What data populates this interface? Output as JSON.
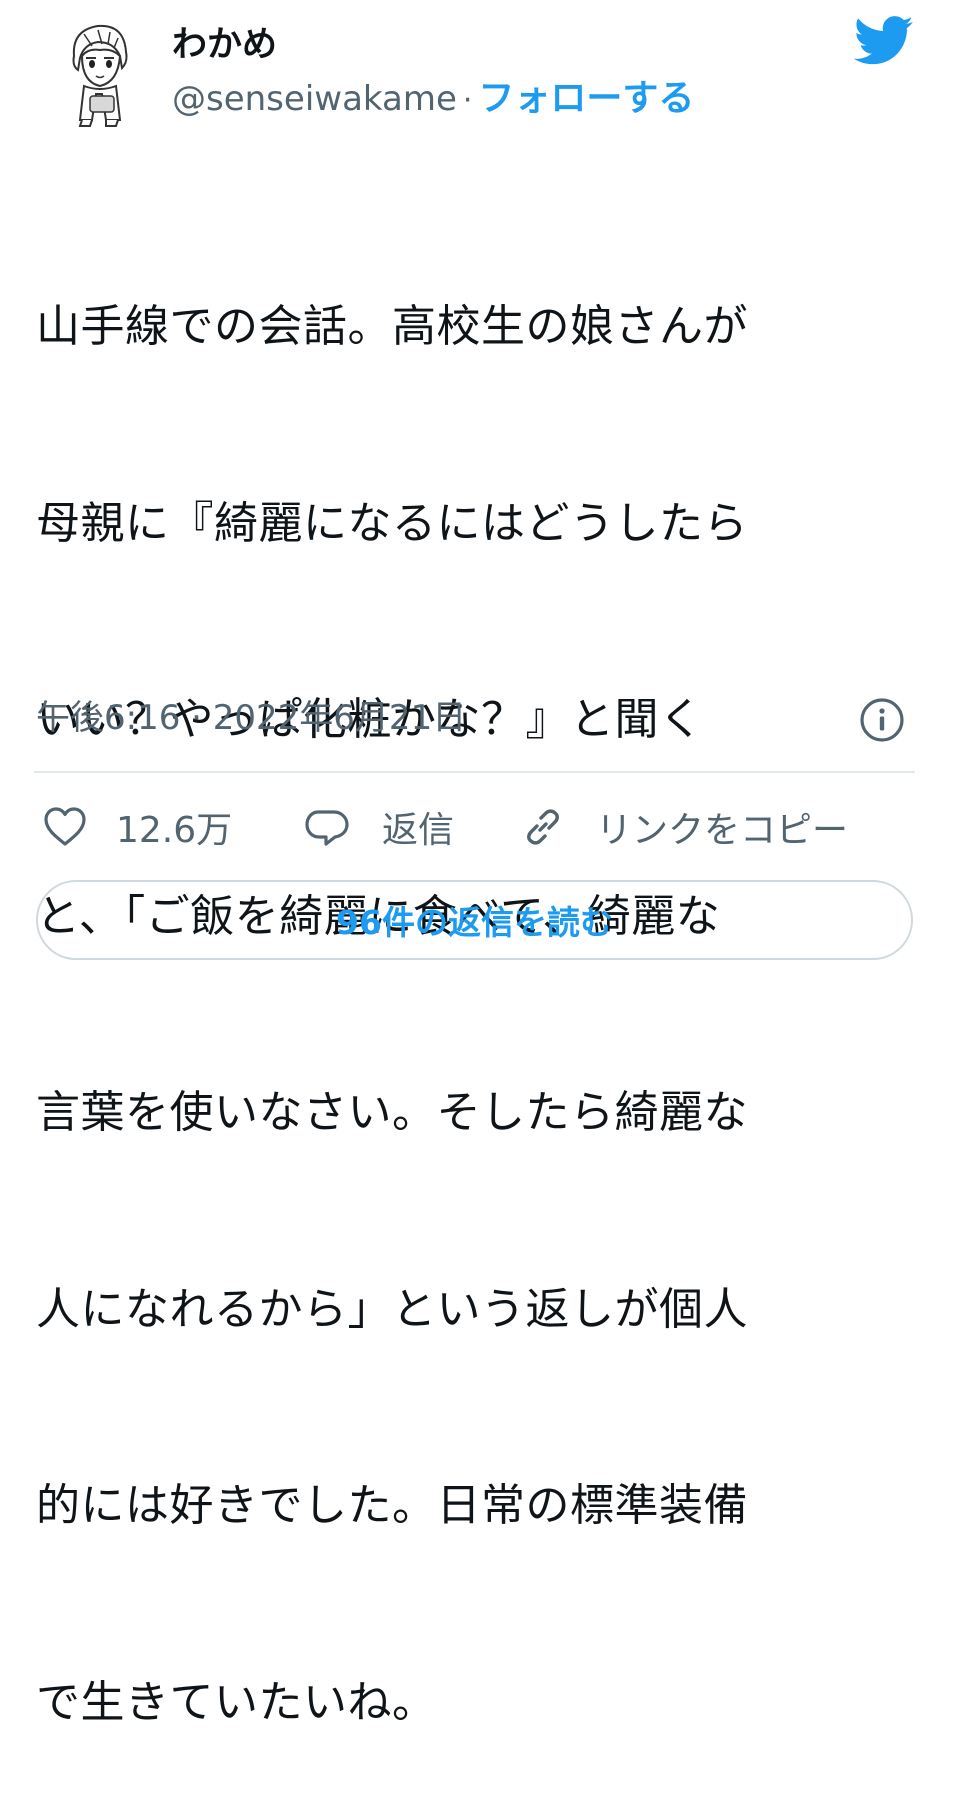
{
  "author": {
    "display_name": "わかめ",
    "handle": "@senseiwakame",
    "separator": "·",
    "follow_label": "フォローする"
  },
  "tweet": {
    "text_lines": [
      "山手線での会話。高校生の娘さんが",
      "母親に『綺麗になるにはどうしたら",
      "いい？やっぱ化粧かな？』と聞く",
      "と、「ご飯を綺麗に食べて、綺麗な",
      "言葉を使いなさい。そしたら綺麗な",
      "人になれるから」という返しが個人",
      "的には好きでした。日常の標準装備",
      "で生きていたいね。"
    ],
    "timestamp": "午後6:16 · 2022年6月21日"
  },
  "actions": {
    "like_count": "12.6万",
    "reply_label": "返信",
    "copy_link_label": "リンクをコピー"
  },
  "read_replies_label": "96件の返信を読む",
  "colors": {
    "accent": "#1d9bf0",
    "text_primary": "#0f1419",
    "text_secondary": "#536471",
    "border": "#cfd9de"
  },
  "icons": {
    "brand": "twitter-bird-icon",
    "info": "info-icon",
    "like": "heart-icon",
    "reply": "speech-bubble-icon",
    "copy_link": "link-icon"
  }
}
